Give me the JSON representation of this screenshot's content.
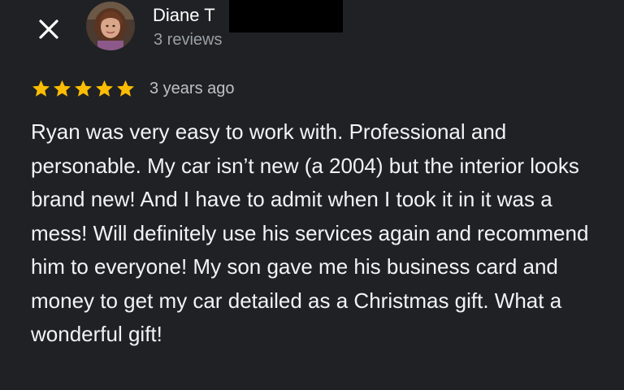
{
  "header": {
    "close_icon": "close-icon",
    "reviewer_name": "Diane T",
    "review_count": "3 reviews"
  },
  "review": {
    "rating": 5,
    "rating_max": 5,
    "star_color": "#fbbc04",
    "date": "3 years ago",
    "text": "Ryan was very easy to work with. Professional and personable. My car isn’t new (a 2004) but the interior looks brand new! And I have to admit when I took it in it was a mess! Will definitely use his services again and recommend him to everyone! My son gave me his business card and money to get my car detailed as a Christmas gift. What a wonderful gift!"
  },
  "theme": {
    "background": "#202124",
    "primary_text": "#ffffff",
    "secondary_text": "#9aa0a6"
  }
}
